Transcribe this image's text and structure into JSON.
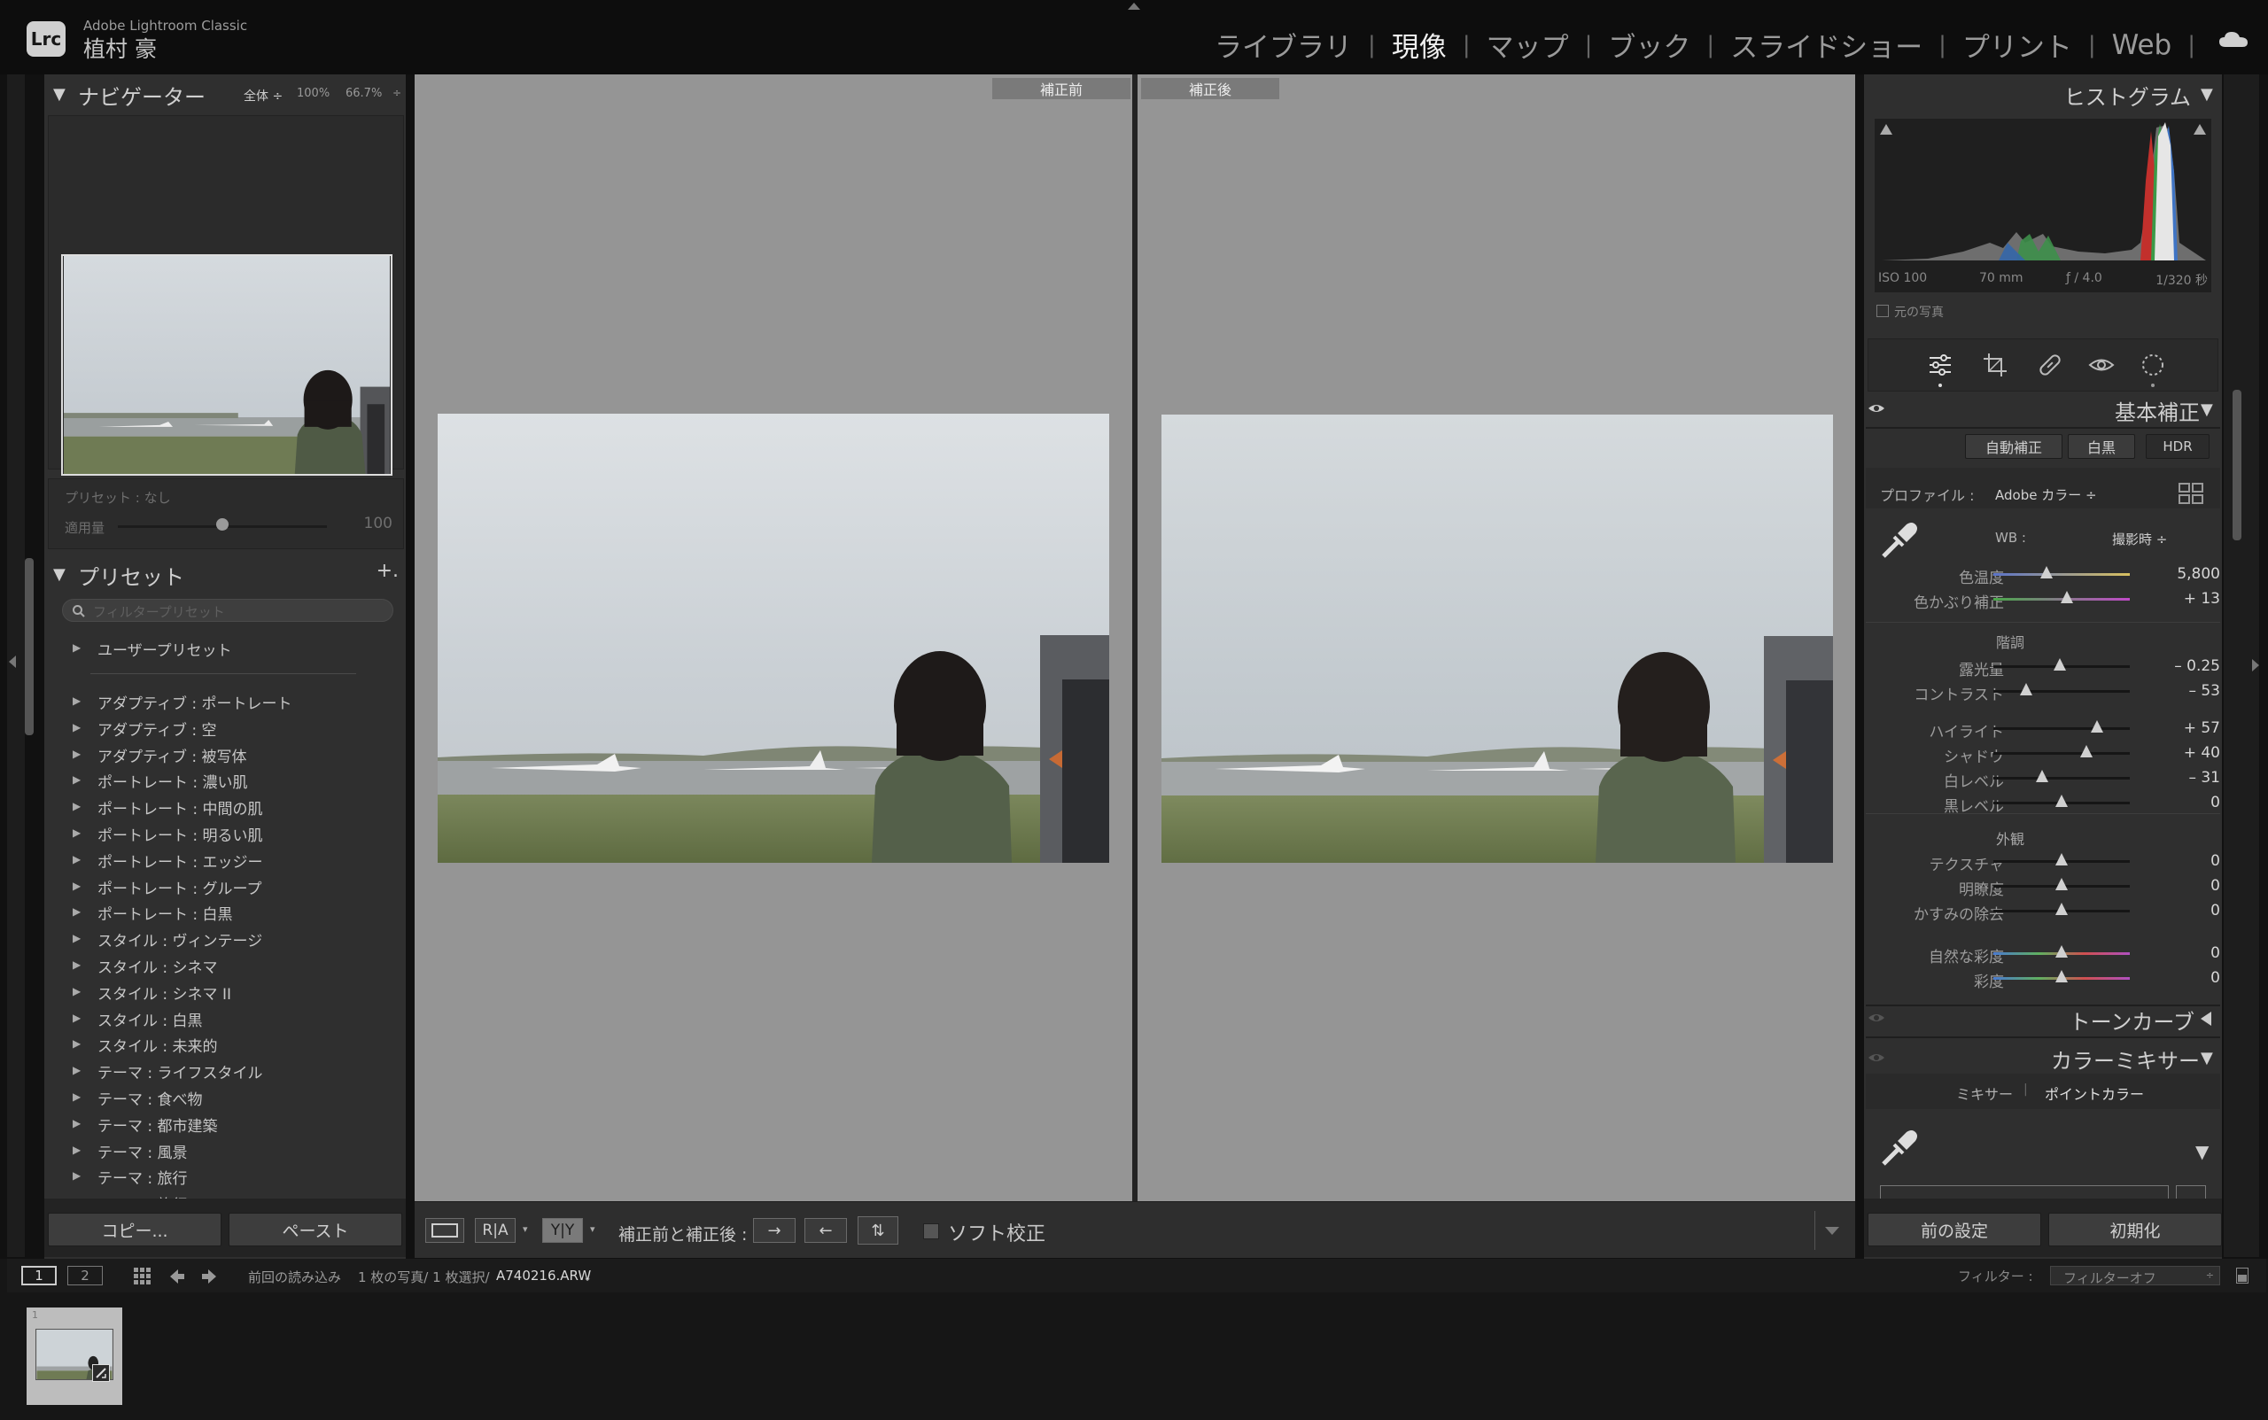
{
  "app": {
    "name": "Adobe Lightroom Classic",
    "logo": "Lrc",
    "user": "植村 豪"
  },
  "modules": [
    "ライブラリ",
    "現像",
    "マップ",
    "ブック",
    "スライドショー",
    "プリント",
    "Web"
  ],
  "active_module": "現像",
  "navigator": {
    "title": "ナビゲーター",
    "zoom_options": [
      "全体 ÷",
      "100%",
      "66.7%"
    ],
    "preset_amount_label": "プリセット : なし",
    "amount_label": "適用量",
    "amount_value": "100",
    "amount": 100
  },
  "presets": {
    "title": "プリセット",
    "add": "+.",
    "filter_placeholder": "フィルタープリセット",
    "groups": [
      "ユーザープリセット",
      "アダプティブ : ポートレート",
      "アダプティブ : 空",
      "アダプティブ : 被写体",
      "ポートレート : 濃い肌",
      "ポートレート : 中間の肌",
      "ポートレート : 明るい肌",
      "ポートレート : エッジー",
      "ポートレート : グループ",
      "ポートレート : 白黒",
      "スタイル : ヴィンテージ",
      "スタイル : シネマ",
      "スタイル : シネマ II",
      "スタイル : 白黒",
      "スタイル : 未来的",
      "テーマ : ライフスタイル",
      "テーマ : 食べ物",
      "テーマ : 都市建築",
      "テーマ : 風景",
      "テーマ : 旅行",
      "テーマ : 旅行 II"
    ],
    "copy": "コピー...",
    "paste": "ペースト"
  },
  "compare": {
    "before": "補正前",
    "after": "補正後"
  },
  "toolbar": {
    "view_ra": "R|A",
    "view_yy": "Y|Y",
    "before_after_label": "補正前と補正後 :",
    "soft_proof": "ソフト校正"
  },
  "histogram": {
    "title": "ヒストグラム",
    "iso": "ISO 100",
    "focal": "70 mm",
    "aperture": "ƒ / 4.0",
    "shutter": "1/320 秒",
    "original_photo": "元の写真"
  },
  "basic": {
    "title": "基本補正",
    "auto": "自動補正",
    "bw": "白黒",
    "hdr": "HDR",
    "profile_label": "プロファイル :",
    "profile_value": "Adobe カラー ÷",
    "wb_label": "WB :",
    "wb_value": "撮影時 ÷",
    "tone_label": "階調",
    "presence_label": "外観",
    "sliders": [
      {
        "label": "色温度",
        "value": "5,800",
        "pos": 0.39
      },
      {
        "label": "色かぶり補正",
        "value": "+ 13",
        "pos": 0.54
      },
      {
        "label": "露光量",
        "value": "– 0.25",
        "pos": 0.49
      },
      {
        "label": "コントラスト",
        "value": "– 53",
        "pos": 0.24
      },
      {
        "label": "ハイライト",
        "value": "+ 57",
        "pos": 0.76
      },
      {
        "label": "シャドウ",
        "value": "+ 40",
        "pos": 0.68
      },
      {
        "label": "白レベル",
        "value": "– 31",
        "pos": 0.36
      },
      {
        "label": "黒レベル",
        "value": "0",
        "pos": 0.5
      },
      {
        "label": "テクスチャ",
        "value": "0",
        "pos": 0.5
      },
      {
        "label": "明瞭度",
        "value": "0",
        "pos": 0.5
      },
      {
        "label": "かすみの除去",
        "value": "0",
        "pos": 0.5
      },
      {
        "label": "自然な彩度",
        "value": "0",
        "pos": 0.5
      },
      {
        "label": "彩度",
        "value": "0",
        "pos": 0.5
      }
    ]
  },
  "tone_curve": {
    "title": "トーンカーブ"
  },
  "color_mixer": {
    "title": "カラーミキサー",
    "tab_mixer": "ミキサー",
    "tab_point": "ポイントカラー"
  },
  "right_buttons": {
    "previous": "前の設定",
    "reset": "初期化"
  },
  "filmstrip": {
    "view1": "1",
    "view2": "2",
    "source": "前回の読み込み",
    "count": "1 枚の写真/ 1 枚選択/",
    "filename": "A740216.ARW",
    "filter_label": "フィルター :",
    "filter_value": "フィルターオフ",
    "thumb_index": "1"
  }
}
